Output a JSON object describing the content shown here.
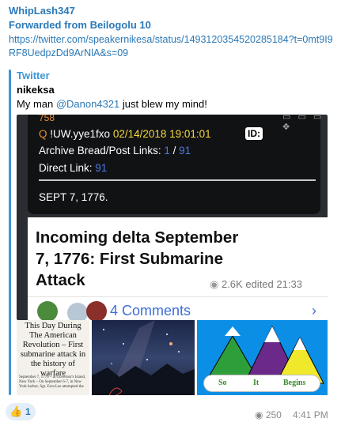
{
  "message": {
    "sender": "WhipLash347",
    "forwarded_from": "Forwarded from Beilogolu 10",
    "url": "https://twitter.com/speakernikesa/status/1493120354520285184?t=0mt9I9RF8UedpzDd9ArNlA&s=09",
    "preview": {
      "site": "Twitter",
      "title": "nikeksa",
      "text_before": "My man ",
      "mention": "@Danon4321",
      "text_after": " just blew my mind!"
    },
    "screenshot": {
      "post_number": "758",
      "q_prefix": "Q",
      "tripcode": "!UW.yye1fxo",
      "date": "02/14/2018 19:01:01",
      "id_label": "ID:",
      "archive_label": "Archive Bread/Post Links:",
      "archive_a": "1",
      "archive_sep": " / ",
      "archive_b": "91",
      "direct_label": "Direct Link:",
      "direct_value": "91",
      "sept_line": "SEPT 7, 1776.",
      "card_title": "Incoming delta September 7, 1776: First Submarine Attack",
      "views": "2.6K",
      "edited": "edited 21:33",
      "comments": "4 Comments",
      "chevron": "›"
    },
    "collage": {
      "doc_heading": "This Day During The American Revolution – First submarine attack in the history of warfare",
      "doc_body": "September 7, 1776 – at Governor's Island, New York – On September 6-7, in New York harbor, Sgt. Ezra Lee attempted the",
      "banner_words": [
        "So",
        "It",
        "Begins"
      ]
    },
    "footer": {
      "reaction_emoji": "👍",
      "reaction_count": "1",
      "views": "250",
      "time": "4:41 PM"
    },
    "colors": {
      "accent": "#2b79b8",
      "preview_bar": "#3b95d8",
      "q_date": "#f7d93a",
      "q_link": "#4c7ae0",
      "comments": "#3d6fd6"
    }
  }
}
